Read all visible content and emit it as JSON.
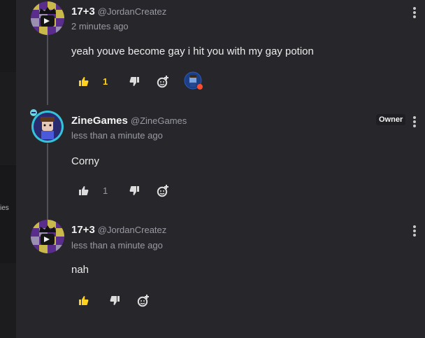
{
  "sidebar": {
    "partial_text": "ies"
  },
  "comments": [
    {
      "username": "17+3",
      "handle": "@JordanCreatez",
      "timestamp": "2 minutes ago",
      "text": "yeah youve become gay i hit you with my gay potion",
      "like_count": "1",
      "liked": true
    },
    {
      "username": "ZineGames",
      "handle": "@ZineGames",
      "timestamp": "less than a minute ago",
      "text": "Corny",
      "like_count": "1",
      "liked": false,
      "badge": "Owner"
    },
    {
      "username": "17+3",
      "handle": "@JordanCreatez",
      "timestamp": "less than a minute ago",
      "text": "nah",
      "liked": true
    }
  ],
  "icons": {
    "like": "thumbs-up-icon",
    "dislike": "thumbs-down-icon",
    "react": "add-reaction-icon",
    "more": "more-vertical-icon"
  },
  "colors": {
    "background": "#26262b",
    "liked": "#ffd21f",
    "neutral_icon": "#dcdcdc",
    "muted_text": "#9a9aa3",
    "avatar_ring": "#34c3d9",
    "online_dot": "#ff4d2e"
  }
}
